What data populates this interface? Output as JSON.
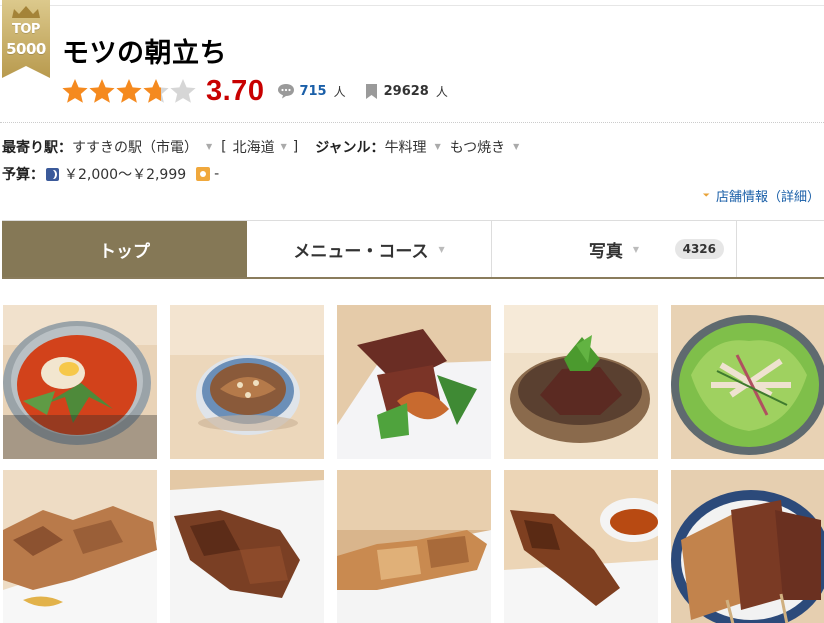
{
  "award": {
    "line1": "TOP",
    "line2": "5000"
  },
  "restaurant": {
    "name": "モツの朝立ち"
  },
  "rating": {
    "score": "3.70",
    "stars": 3.7,
    "max_stars": 5,
    "star_color": "#f58a1f",
    "score_color": "#c80000"
  },
  "reviews": {
    "count": "715",
    "unit": "人"
  },
  "bookmarks": {
    "count": "29628",
    "unit": "人"
  },
  "info": {
    "station_label": "最寄り駅：",
    "station": "すすきの駅（市電）",
    "bracket_open": "[",
    "area": "北海道",
    "bracket_close": "]",
    "genre_label": "ジャンル：",
    "genre1": "牛料理",
    "genre2": "もつ焼き",
    "budget_label": "予算：",
    "dinner_budget": "￥2,000～￥2,999",
    "lunch_budget": "-"
  },
  "detail_link": "店舗情報（詳細）",
  "tabs": [
    {
      "label": "トップ",
      "active": true
    },
    {
      "label": "メニュー・コース",
      "active": false
    },
    {
      "label": "写真",
      "count": "4326",
      "active": false
    }
  ],
  "photos": [
    {
      "icon": "stew-photo-icon"
    },
    {
      "icon": "dish-photo-icon"
    },
    {
      "icon": "tataki-photo-icon"
    },
    {
      "icon": "beef-bowl-photo-icon"
    },
    {
      "icon": "salad-photo-icon"
    },
    {
      "icon": "skewer-photo-icon"
    },
    {
      "icon": "skewer-photo-icon"
    },
    {
      "icon": "skewer-photo-icon"
    },
    {
      "icon": "skewer-photo-icon"
    },
    {
      "icon": "skewer-photo-icon"
    }
  ],
  "colors": {
    "tab_active": "#857856",
    "link": "#1a5fa8",
    "award_gold": "#c9b16b"
  }
}
